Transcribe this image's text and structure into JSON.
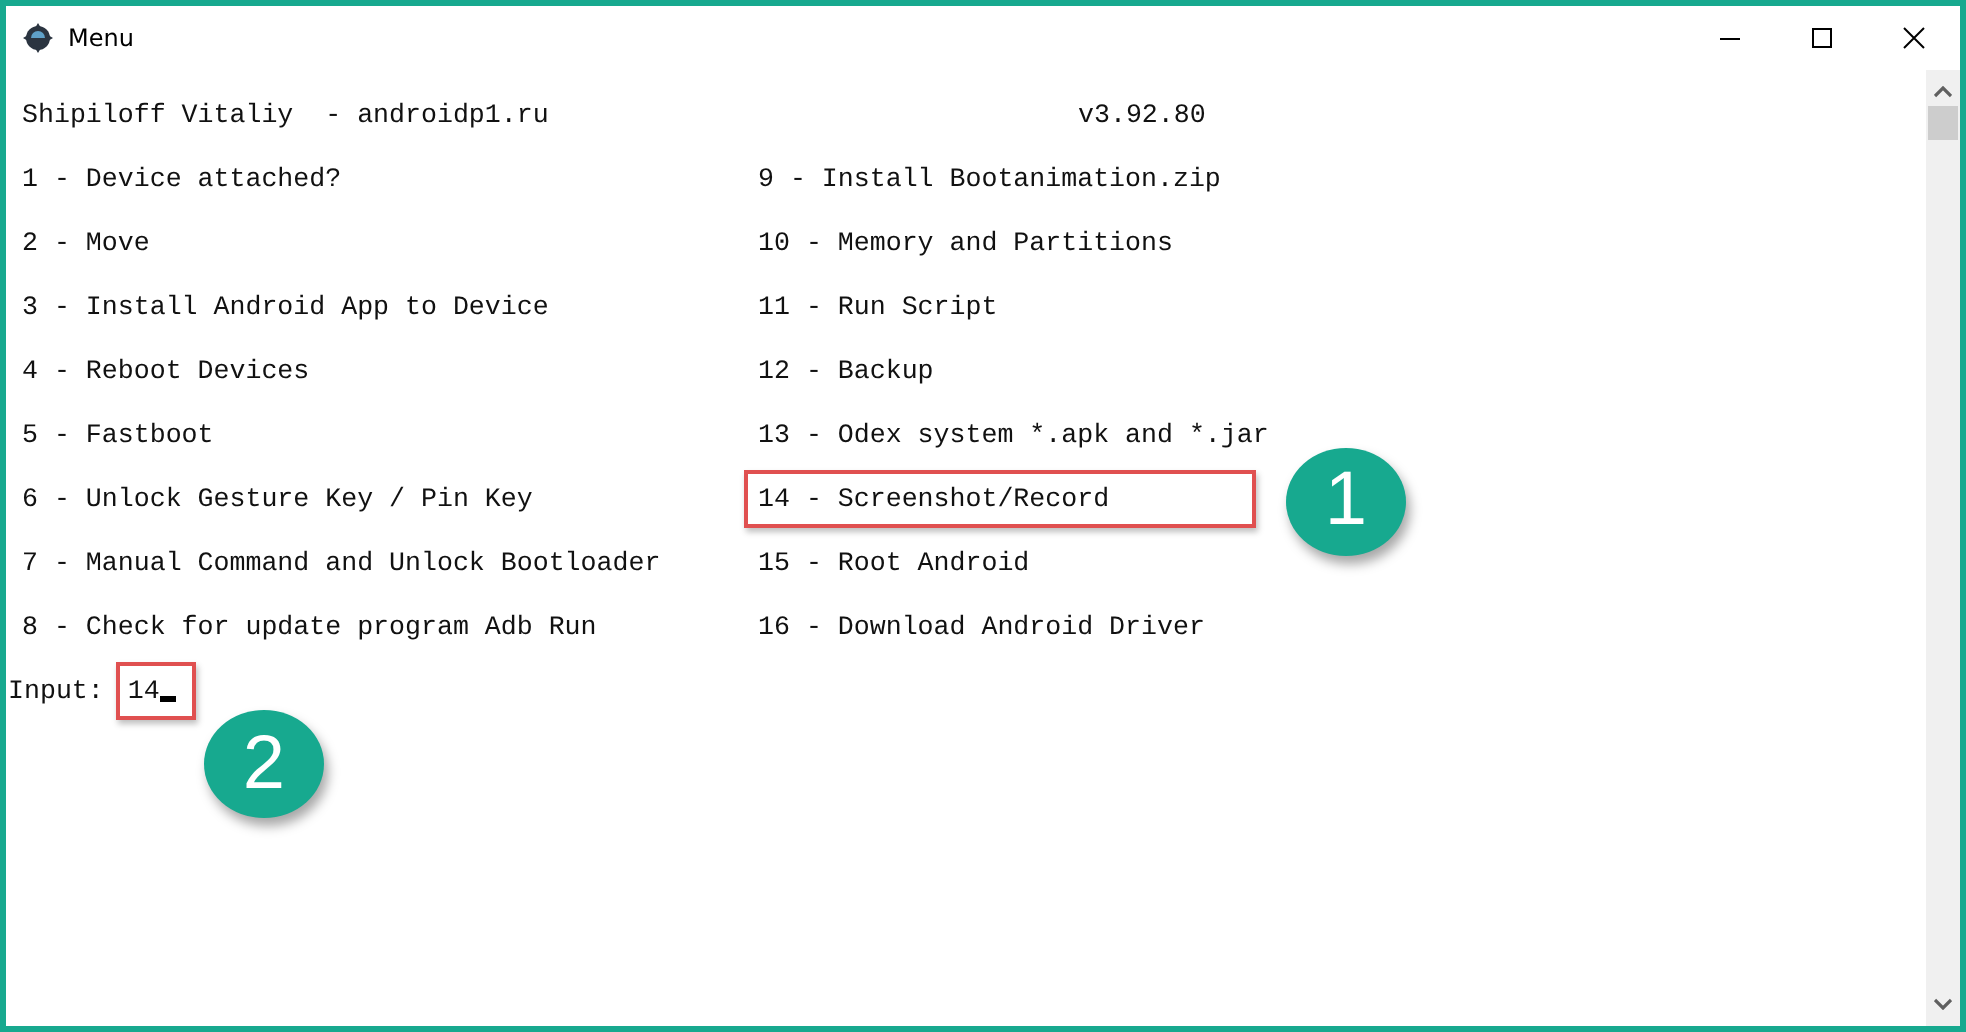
{
  "window": {
    "title": "Menu"
  },
  "header": {
    "author": "Shipiloff Vitaliy  - androidp1.ru",
    "version": "v3.92.80"
  },
  "menu": {
    "left": [
      {
        "text": "1 - Device attached?",
        "highlighted": false
      },
      {
        "text": "2 - Move",
        "highlighted": false
      },
      {
        "text": "3 - Install Android App to Device",
        "highlighted": false
      },
      {
        "text": "4 - Reboot Devices",
        "highlighted": false
      },
      {
        "text": "5 - Fastboot",
        "highlighted": false
      },
      {
        "text": "6 - Unlock Gesture Key / Pin Key",
        "highlighted": false
      },
      {
        "text": "7 - Manual Command and Unlock Bootloader",
        "highlighted": false
      },
      {
        "text": "8 - Check for update program Adb Run",
        "highlighted": false
      }
    ],
    "right": [
      {
        "text": "9 - Install Bootanimation.zip",
        "highlighted": false
      },
      {
        "text": "10 - Memory and Partitions",
        "highlighted": false
      },
      {
        "text": "11 - Run Script",
        "highlighted": false
      },
      {
        "text": "12 - Backup",
        "highlighted": false
      },
      {
        "text": "13 - Odex system *.apk and *.jar",
        "highlighted": false
      },
      {
        "text": "14 - Screenshot/Record",
        "highlighted": true,
        "callout": "1"
      },
      {
        "text": "15 - Root Android",
        "highlighted": false
      },
      {
        "text": "16 - Download Android Driver",
        "highlighted": false
      }
    ]
  },
  "input": {
    "label": "Input:",
    "value": "14",
    "highlighted": true,
    "callout": "2"
  }
}
